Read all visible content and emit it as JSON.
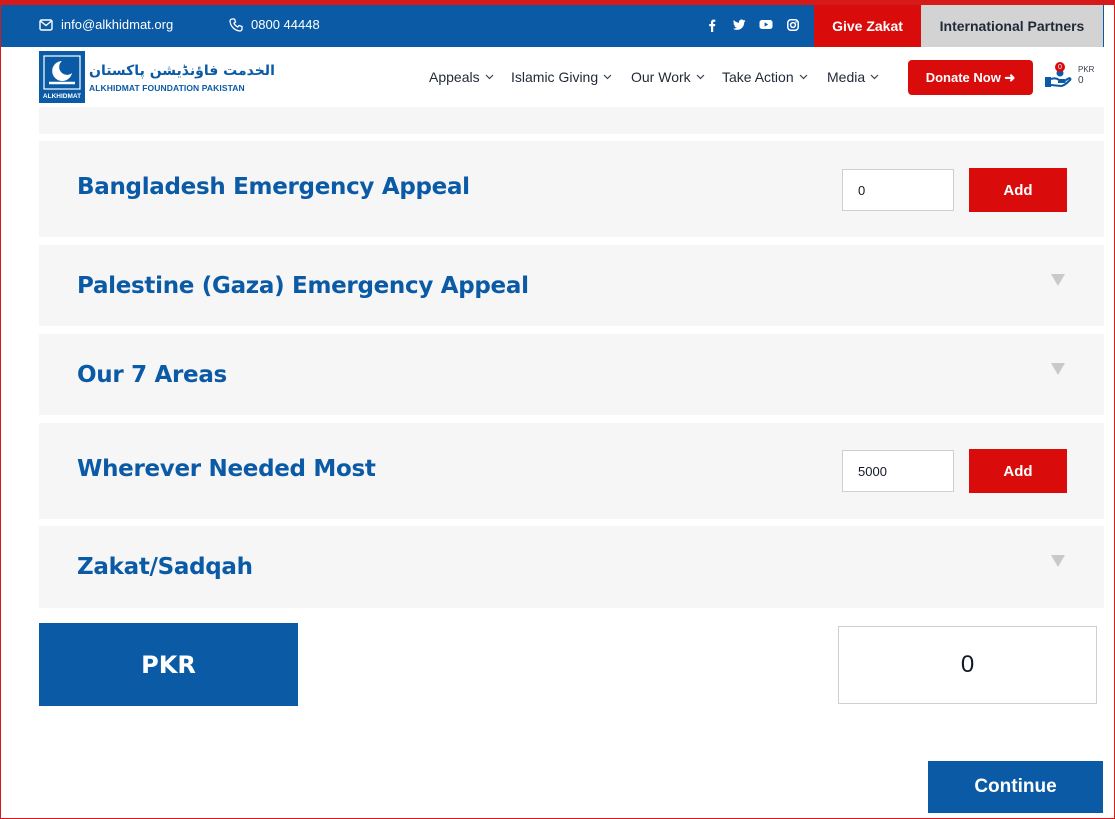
{
  "topbar": {
    "email": "info@alkhidmat.org",
    "phone": "0800 44448",
    "social_icons": [
      "facebook-icon",
      "twitter-icon",
      "youtube-icon",
      "instagram-icon"
    ],
    "give_zakat": "Give Zakat",
    "international_partners": "International Partners"
  },
  "header": {
    "logo_urdu": "الخدمت فاؤنڈیشن پاکستان",
    "logo_english": "ALKHIDMAT FOUNDATION PAKISTAN",
    "logo_box_text": "ALKHIDMAT",
    "nav": [
      "Appeals",
      "Islamic Giving",
      "Our Work",
      "Take Action",
      "Media"
    ],
    "donate_now": "Donate Now ➜",
    "cart_count": "0",
    "cart_currency": "PKR",
    "cart_amount": "0"
  },
  "panels": [
    {
      "title": "Bangladesh Emergency Appeal",
      "amount": "0",
      "add_label": "Add",
      "expanded": true
    },
    {
      "title": "Palestine (Gaza) Emergency Appeal",
      "expanded": false
    },
    {
      "title": "Our 7 Areas",
      "expanded": false
    },
    {
      "title": "Wherever Needed Most",
      "amount": "5000",
      "add_label": "Add",
      "expanded": true
    },
    {
      "title": "Zakat/Sadqah",
      "expanded": false
    }
  ],
  "totals": {
    "currency": "PKR",
    "amount": "0"
  },
  "continue_label": "Continue",
  "colors": {
    "brand_blue": "#0b5aa6",
    "accent_red": "#d90b0b",
    "panel_bg": "#f6f6f6",
    "partners_bg": "#d3d3d3"
  }
}
